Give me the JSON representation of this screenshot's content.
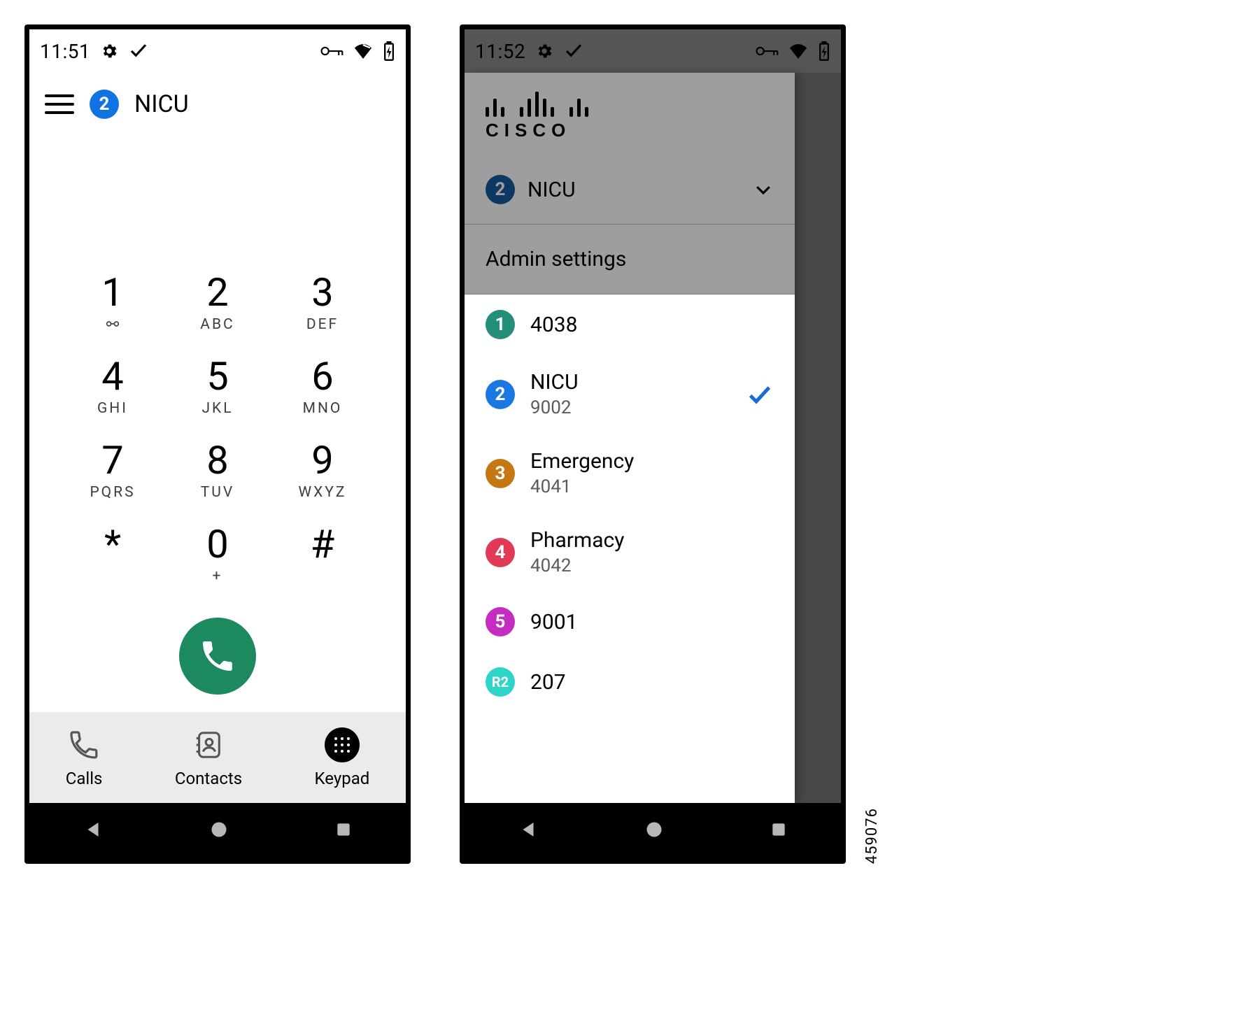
{
  "image_id": "459076",
  "phone1": {
    "status": {
      "time": "11:51"
    },
    "line_badge": "2",
    "title": "NICU",
    "keypad": [
      {
        "digit": "1",
        "letters": "",
        "vm": true
      },
      {
        "digit": "2",
        "letters": "ABC"
      },
      {
        "digit": "3",
        "letters": "DEF"
      },
      {
        "digit": "4",
        "letters": "GHI"
      },
      {
        "digit": "5",
        "letters": "JKL"
      },
      {
        "digit": "6",
        "letters": "MNO"
      },
      {
        "digit": "7",
        "letters": "PQRS"
      },
      {
        "digit": "8",
        "letters": "TUV"
      },
      {
        "digit": "9",
        "letters": "WXYZ"
      },
      {
        "digit": "*",
        "letters": ""
      },
      {
        "digit": "0",
        "letters": "+"
      },
      {
        "digit": "#",
        "letters": ""
      }
    ],
    "tabs": {
      "calls": "Calls",
      "contacts": "Contacts",
      "keypad": "Keypad"
    }
  },
  "phone2": {
    "status": {
      "time": "11:52"
    },
    "brand": "CISCO",
    "current_line": {
      "badge": "2",
      "name": "NICU"
    },
    "admin": "Admin settings",
    "lines": [
      {
        "badge": "1",
        "color": "#238e7a",
        "name": "4038",
        "number": "",
        "selected": false
      },
      {
        "badge": "2",
        "color": "#1a78e0",
        "name": "NICU",
        "number": "9002",
        "selected": true
      },
      {
        "badge": "3",
        "color": "#c47814",
        "name": "Emergency",
        "number": "4041",
        "selected": false
      },
      {
        "badge": "4",
        "color": "#e13a57",
        "name": "Pharmacy",
        "number": "4042",
        "selected": false
      },
      {
        "badge": "5",
        "color": "#c52dc0",
        "name": "9001",
        "number": "",
        "selected": false
      },
      {
        "badge": "R2",
        "color": "#2fd4c9",
        "name": "207",
        "number": "",
        "selected": false
      }
    ]
  }
}
